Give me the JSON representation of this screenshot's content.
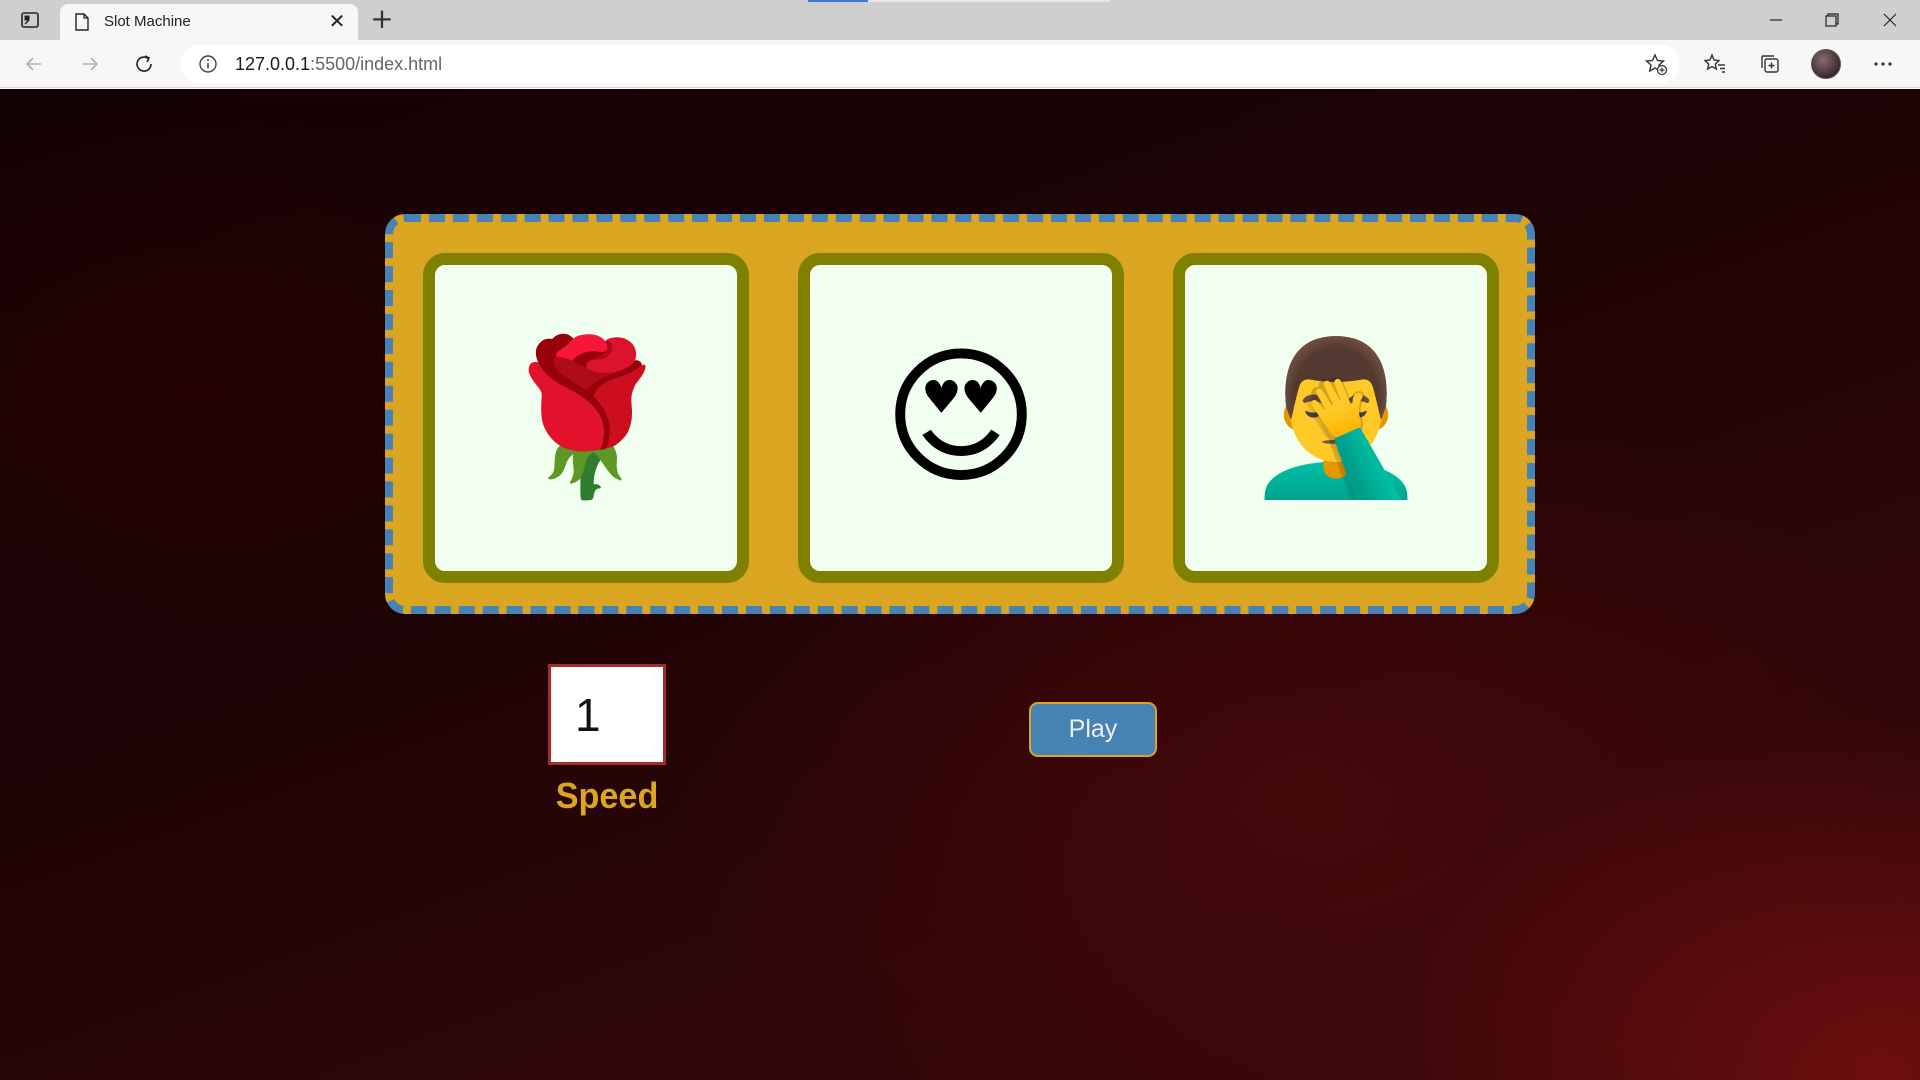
{
  "browser": {
    "tab_title": "Slot Machine",
    "tab_close": "✕",
    "new_tab": "+",
    "url_host": "127.0.0.1",
    "url_rest": ":5500/index.html",
    "icons": [
      "tab-actions-icon",
      "page-icon",
      "close-icon",
      "new-tab-icon",
      "minimize-icon",
      "restore-icon",
      "window-close-icon",
      "back-icon",
      "forward-icon",
      "refresh-icon",
      "info-icon",
      "add-favorite-icon",
      "favorites-icon",
      "collections-icon",
      "more-icon"
    ]
  },
  "slot_machine": {
    "reels": [
      {
        "symbol": "🌹",
        "icon": "rose-icon"
      },
      {
        "symbol": "😍",
        "icon": "heart-eyes-face-icon"
      },
      {
        "symbol": "🤦‍♂️",
        "icon": "man-facepalming-icon"
      }
    ],
    "speed_value": "1",
    "speed_label": "Speed",
    "play_label": "Play"
  },
  "colors": {
    "frame": "#daa520",
    "frame_dashes": "#4682b4",
    "reel_border": "#808000",
    "reel_bg": "#f0fff0",
    "play_button": "#4682b4",
    "speed_border": "#a52a2a"
  }
}
